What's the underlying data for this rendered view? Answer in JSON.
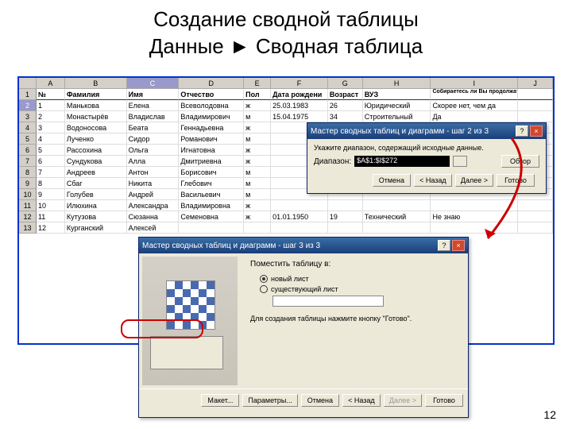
{
  "title_line1": "Создание сводной таблицы",
  "title_line2": "Данные ► Сводная таблица",
  "page_number": "12",
  "columns": [
    "A",
    "B",
    "C",
    "D",
    "E",
    "F",
    "G",
    "H",
    "I",
    "J"
  ],
  "headers": {
    "A": "№",
    "B": "Фамилия",
    "C": "Имя",
    "D": "Отчество",
    "E": "Пол",
    "F": "Дата рождени",
    "G": "Возраст",
    "H": "ВУЗ",
    "I": "Собираетесь ли Вы продолжать образование?"
  },
  "rows": [
    {
      "n": "2",
      "A": "1",
      "B": "Манькова",
      "C": "Елена",
      "D": "Всеволодовна",
      "E": "ж",
      "F": "25.03.1983",
      "G": "26",
      "H": "Юридический",
      "I": "Скорее нет, чем да"
    },
    {
      "n": "3",
      "A": "2",
      "B": "Монастырёв",
      "C": "Владислав",
      "D": "Владимирович",
      "E": "м",
      "F": "15.04.1975",
      "G": "34",
      "H": "Строительный",
      "I": "Да"
    },
    {
      "n": "4",
      "A": "3",
      "B": "Водоносова",
      "C": "Беата",
      "D": "Геннадьевна",
      "E": "ж",
      "F": "",
      "G": "",
      "H": "",
      "I": ""
    },
    {
      "n": "5",
      "A": "4",
      "B": "Лученко",
      "C": "Сидор",
      "D": "Романович",
      "E": "м",
      "F": "",
      "G": "",
      "H": "",
      "I": ""
    },
    {
      "n": "6",
      "A": "5",
      "B": "Рассохина",
      "C": "Ольга",
      "D": "Игнатовна",
      "E": "ж",
      "F": "",
      "G": "",
      "H": "",
      "I": ""
    },
    {
      "n": "7",
      "A": "6",
      "B": "Сундукова",
      "C": "Алла",
      "D": "Дмитриевна",
      "E": "ж",
      "F": "",
      "G": "",
      "H": "",
      "I": ""
    },
    {
      "n": "8",
      "A": "7",
      "B": "Андреев",
      "C": "Антон",
      "D": "Борисович",
      "E": "м",
      "F": "",
      "G": "",
      "H": "",
      "I": ""
    },
    {
      "n": "9",
      "A": "8",
      "B": "Сбаг",
      "C": "Никита",
      "D": "Глебович",
      "E": "м",
      "F": "",
      "G": "",
      "H": "",
      "I": ""
    },
    {
      "n": "10",
      "A": "9",
      "B": "Голубев",
      "C": "Андрей",
      "D": "Васильевич",
      "E": "м",
      "F": "",
      "G": "",
      "H": "",
      "I": ""
    },
    {
      "n": "11",
      "A": "10",
      "B": "Илюхина",
      "C": "Александра",
      "D": "Владимировна",
      "E": "ж",
      "F": "",
      "G": "",
      "H": "",
      "I": ""
    },
    {
      "n": "12",
      "A": "11",
      "B": "Кутузова",
      "C": "Сюзанна",
      "D": "Семеновна",
      "E": "ж",
      "F": "01.01.1950",
      "G": "19",
      "H": "Технический",
      "I": "Не знаю"
    },
    {
      "n": "13",
      "A": "12",
      "B": "Курганский",
      "C": "Алексей",
      "D": "",
      "E": "",
      "F": "",
      "G": "",
      "H": "",
      "I": ""
    }
  ],
  "dlg1": {
    "title": "Мастер сводных таблиц и диаграмм - шаг 2 из 3",
    "prompt": "Укажите диапазон, содержащий исходные данные.",
    "range_label": "Диапазон:",
    "range_value": "$A$1:$I$272",
    "browse": "Обзор",
    "cancel": "Отмена",
    "back": "< Назад",
    "next": "Далее >",
    "finish": "Готово"
  },
  "dlg2": {
    "title": "Мастер сводных таблиц и диаграмм - шаг 3 из 3",
    "question": "Поместить таблицу в:",
    "opt1": "новый лист",
    "opt2": "существующий лист",
    "hint": "Для создания таблицы нажмите кнопку \"Готово\".",
    "layout": "Макет...",
    "params": "Параметры...",
    "cancel": "Отмена",
    "back": "< Назад",
    "next": "Далее >",
    "finish": "Готово"
  }
}
